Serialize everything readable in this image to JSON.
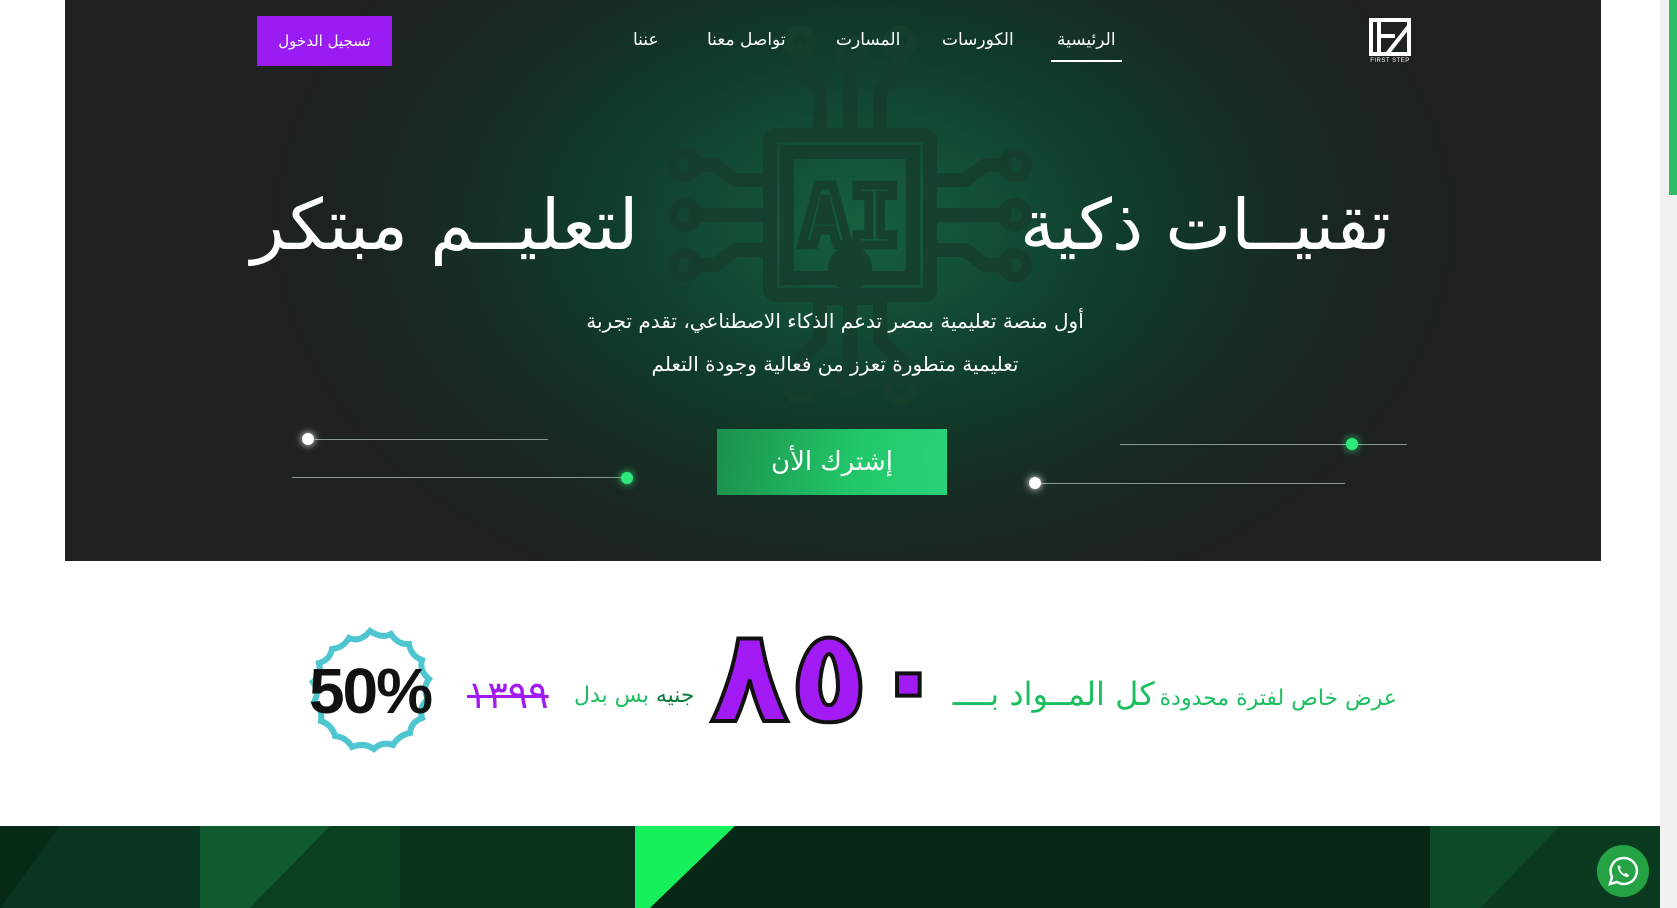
{
  "nav": {
    "logo_text": "FIRST STEP",
    "links": [
      {
        "label": "الرئيسية",
        "active": true
      },
      {
        "label": "الكورسات"
      },
      {
        "label": "المسارت"
      },
      {
        "label": "تواصل معنا"
      },
      {
        "label": "عننا"
      }
    ],
    "login_label": "تسجيل الدخول"
  },
  "hero": {
    "title_right": "تقنيــات ذكية",
    "title_left": "لتعليــم مبتكر",
    "art_label": "AI",
    "description_line1": "أول منصة تعليمية بمصر تدعم الذكاء الاصطناعي، تقدم تجربة",
    "description_line2": "تعليمية متطورة تعزز من فعالية وجودة التعلم",
    "cta_label": "إشترك الأن"
  },
  "offer": {
    "badge": "50%",
    "text_small": "عرض خاص لفترة محدودة",
    "text_big": "كل المــواد بــــ",
    "new_price": "٨٥٠",
    "currency_instead": "جنيه",
    "instead_of": "بس بدل",
    "old_price": "١٣٩٩"
  },
  "colors": {
    "accent_purple": "#9b1cf2",
    "accent_green": "#22c76a",
    "hero_dark": "#1e2220",
    "strip_dark": "#072a17"
  },
  "icons": {
    "whatsapp": "whatsapp-icon",
    "logo": "first-step-logo"
  }
}
